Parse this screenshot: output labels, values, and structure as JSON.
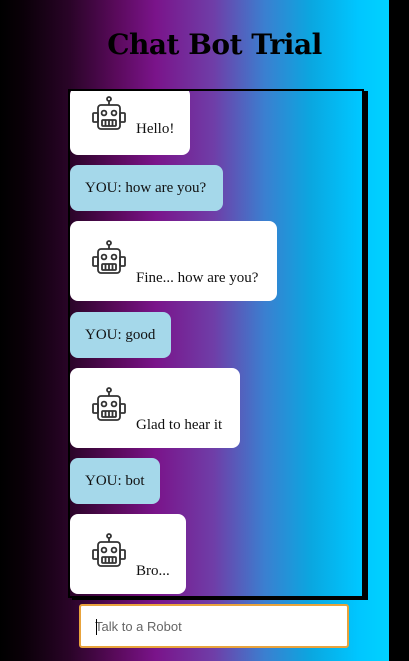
{
  "app": {
    "title": "Chat Bot Trial"
  },
  "messages": [
    {
      "sender": "bot",
      "text": "Hello!",
      "icon": "robot-icon"
    },
    {
      "sender": "user",
      "text": "YOU: how are you?"
    },
    {
      "sender": "bot",
      "text": "Fine... how are you?",
      "icon": "robot-icon"
    },
    {
      "sender": "user",
      "text": "YOU: good"
    },
    {
      "sender": "bot",
      "text": "Glad to hear it",
      "icon": "robot-icon"
    },
    {
      "sender": "user",
      "text": "YOU: bot"
    },
    {
      "sender": "bot",
      "text": "Bro...",
      "icon": "robot-icon"
    }
  ],
  "input": {
    "placeholder": "Talk to a Robot",
    "value": ""
  },
  "colors": {
    "user_bubble": "#a5d8ea",
    "bot_bubble": "#ffffff",
    "input_border": "#e8a33c"
  }
}
